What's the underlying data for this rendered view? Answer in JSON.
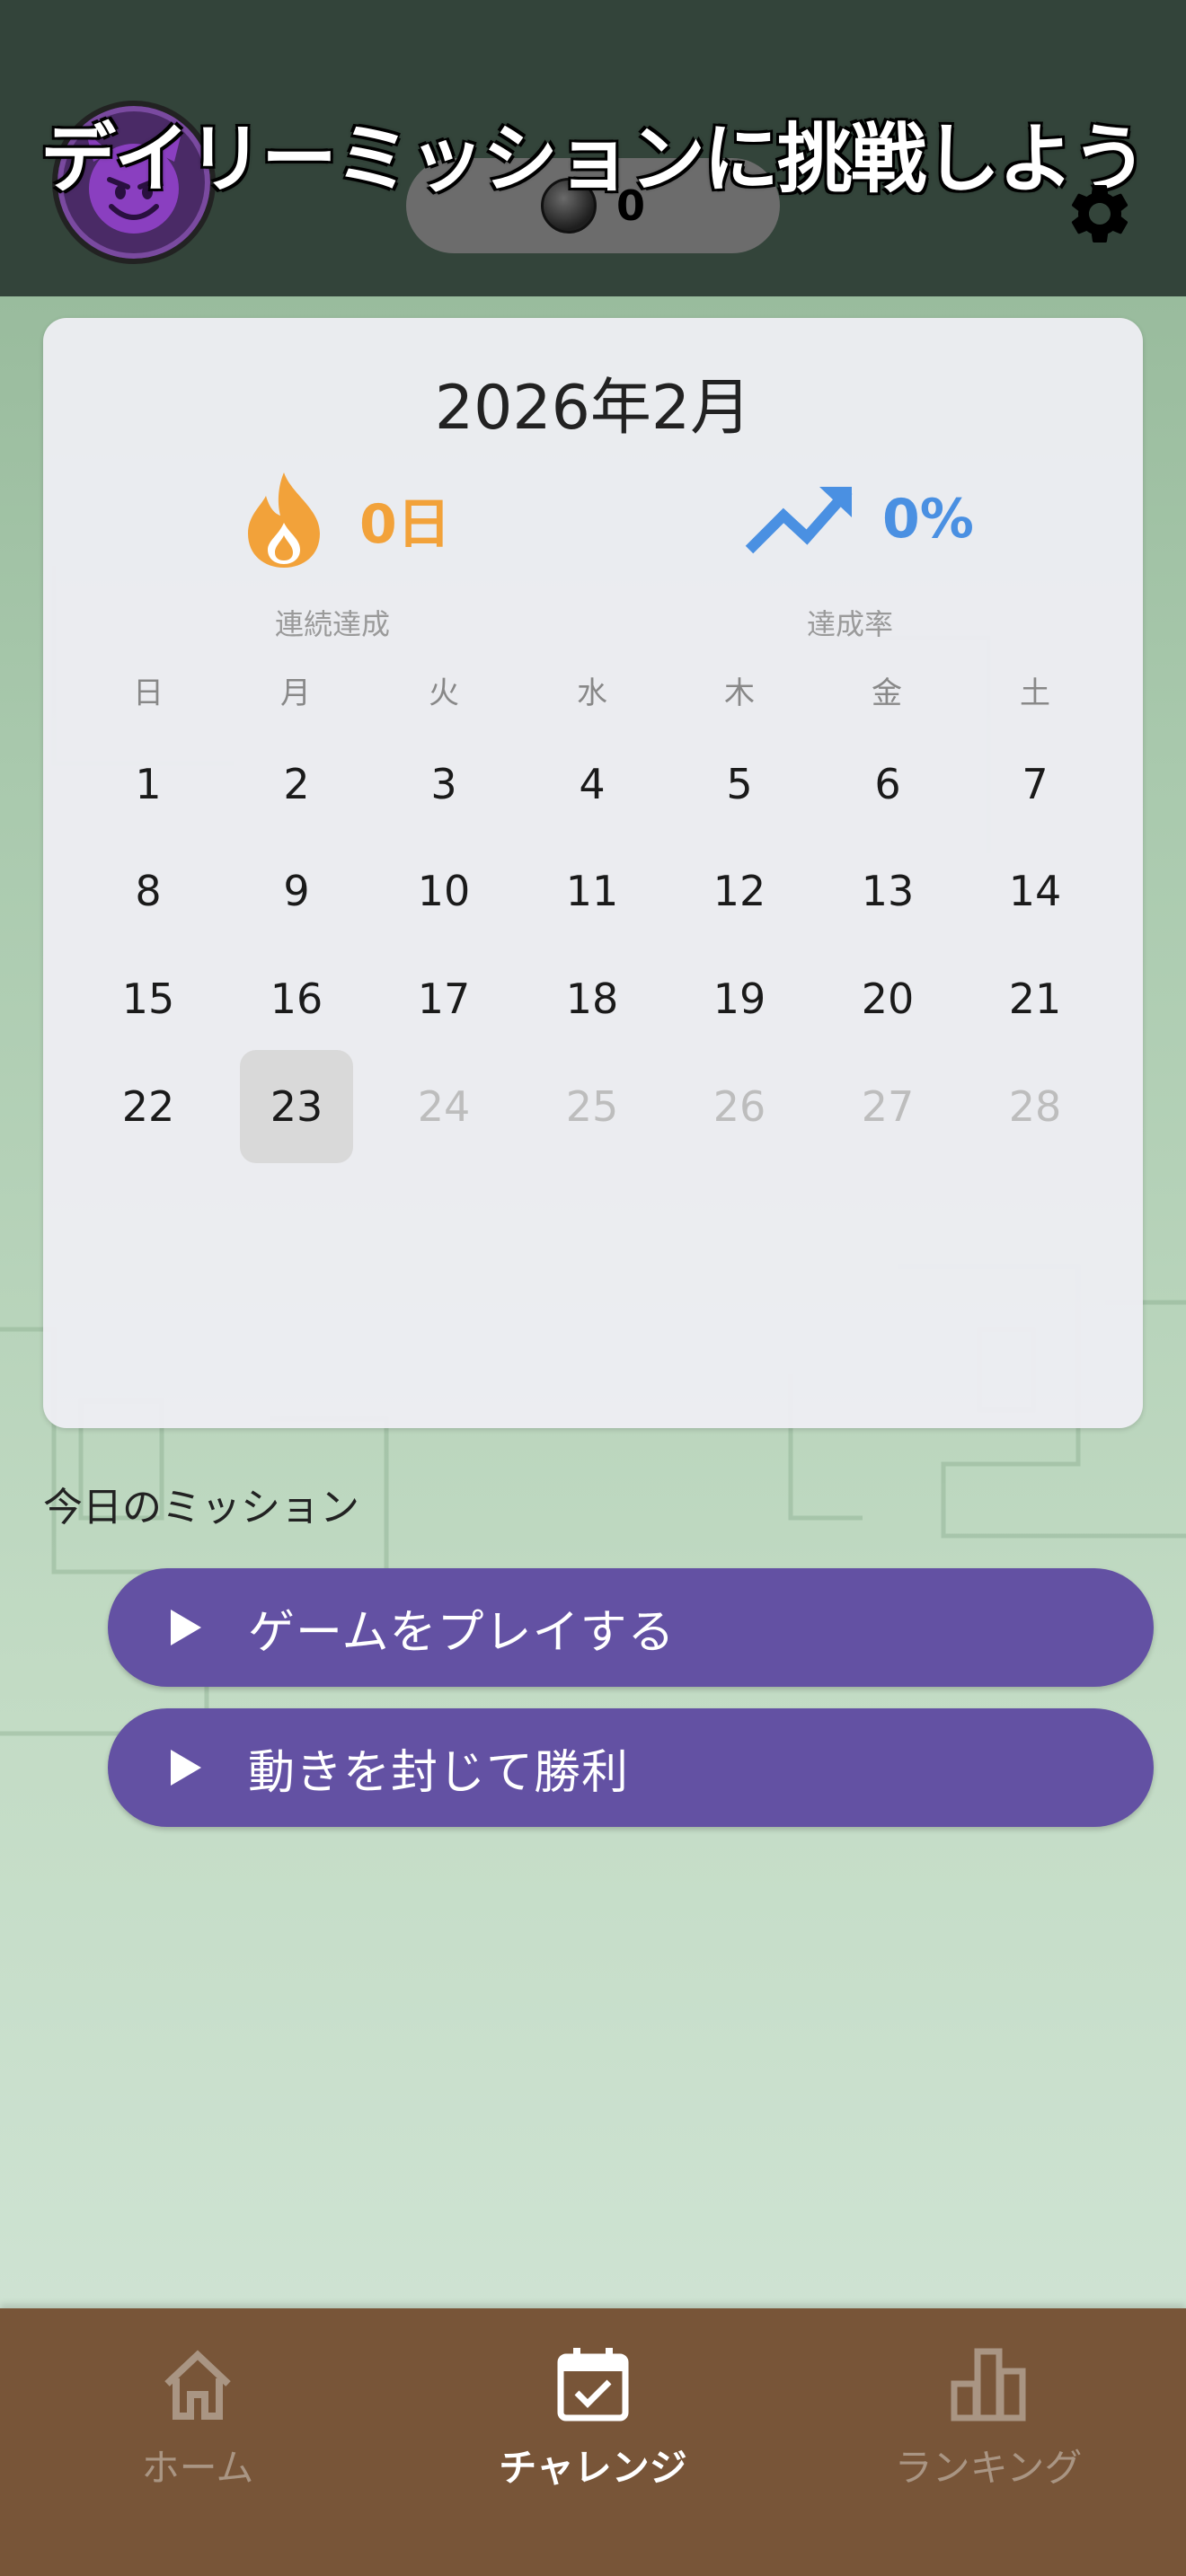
{
  "header": {
    "title": "デイリーミッションに挑戦しよう",
    "coin_count": "0",
    "avatar_icon": "smiling-devil-icon",
    "settings_icon": "gear-icon"
  },
  "calendar": {
    "month_title": "2026年2月",
    "streak": {
      "value": "0日",
      "label": "連続達成",
      "icon": "flame-icon",
      "color": "#f2a23a"
    },
    "rate": {
      "value": "0%",
      "label": "達成率",
      "icon": "trending-up-icon",
      "color": "#4a90e2"
    },
    "weekdays": [
      "日",
      "月",
      "火",
      "水",
      "木",
      "金",
      "土"
    ],
    "weeks": [
      [
        "1",
        "2",
        "3",
        "4",
        "5",
        "6",
        "7"
      ],
      [
        "8",
        "9",
        "10",
        "11",
        "12",
        "13",
        "14"
      ],
      [
        "15",
        "16",
        "17",
        "18",
        "19",
        "20",
        "21"
      ],
      [
        "22",
        "23",
        "24",
        "25",
        "26",
        "27",
        "28"
      ]
    ],
    "today": "23"
  },
  "missions": {
    "section_title": "今日のミッション",
    "items": [
      {
        "label": "ゲームをプレイする",
        "icon": "play-icon"
      },
      {
        "label": "動きを封じて勝利",
        "icon": "play-icon"
      }
    ],
    "button_color": "#6351a3"
  },
  "tabbar": {
    "items": [
      {
        "label": "ホーム",
        "icon": "home-icon"
      },
      {
        "label": "チャレンジ",
        "icon": "calendar-check-icon"
      },
      {
        "label": "ランキング",
        "icon": "bar-chart-icon"
      }
    ],
    "active_index": 1,
    "background": "#785538"
  }
}
